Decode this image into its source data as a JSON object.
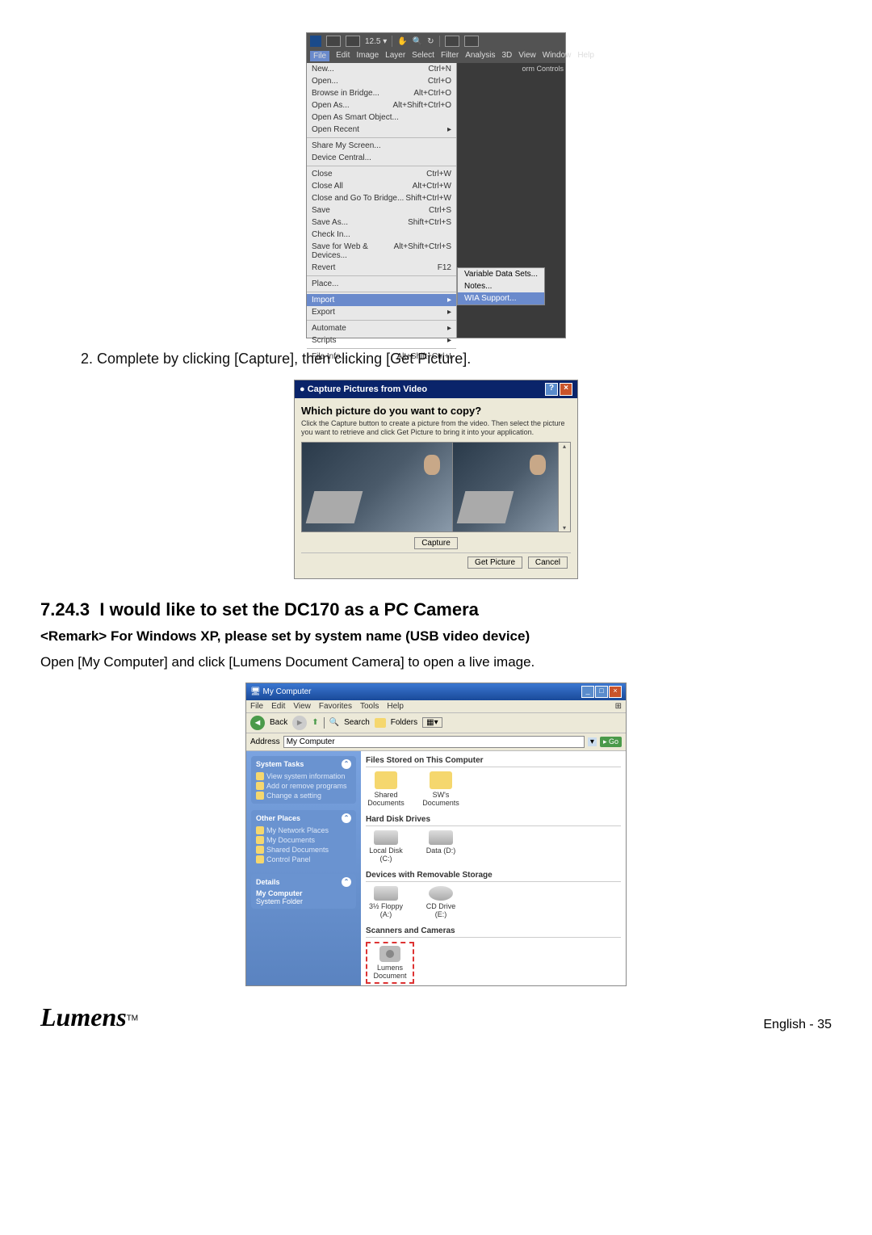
{
  "ps": {
    "zoom": "12.5 ▾",
    "menubar": [
      "File",
      "Edit",
      "Image",
      "Layer",
      "Select",
      "Filter",
      "Analysis",
      "3D",
      "View",
      "Window",
      "Help"
    ],
    "right_label": "orm Controls",
    "file_menu": [
      {
        "l": "New...",
        "s": "Ctrl+N"
      },
      {
        "l": "Open...",
        "s": "Ctrl+O"
      },
      {
        "l": "Browse in Bridge...",
        "s": "Alt+Ctrl+O"
      },
      {
        "l": "Open As...",
        "s": "Alt+Shift+Ctrl+O"
      },
      {
        "l": "Open As Smart Object...",
        "s": ""
      },
      {
        "l": "Open Recent",
        "s": "▸"
      },
      {
        "sep": true
      },
      {
        "l": "Share My Screen...",
        "s": ""
      },
      {
        "l": "Device Central...",
        "s": ""
      },
      {
        "sep": true
      },
      {
        "l": "Close",
        "s": "Ctrl+W"
      },
      {
        "l": "Close All",
        "s": "Alt+Ctrl+W"
      },
      {
        "l": "Close and Go To Bridge...",
        "s": "Shift+Ctrl+W"
      },
      {
        "l": "Save",
        "s": "Ctrl+S"
      },
      {
        "l": "Save As...",
        "s": "Shift+Ctrl+S"
      },
      {
        "l": "Check In...",
        "s": ""
      },
      {
        "l": "Save for Web & Devices...",
        "s": "Alt+Shift+Ctrl+S"
      },
      {
        "l": "Revert",
        "s": "F12"
      },
      {
        "sep": true
      },
      {
        "l": "Place...",
        "s": ""
      },
      {
        "sep": true
      },
      {
        "l": "Import",
        "s": "▸",
        "hl": true
      },
      {
        "l": "Export",
        "s": "▸"
      },
      {
        "sep": true
      },
      {
        "l": "Automate",
        "s": "▸"
      },
      {
        "l": "Scripts",
        "s": "▸"
      },
      {
        "sep": true
      },
      {
        "l": "File Info...",
        "s": "Alt+Shift+Ctrl+I"
      }
    ],
    "submenu": [
      "Variable Data Sets...",
      "Notes...",
      "WIA Support..."
    ]
  },
  "instruction2": "2.  Complete by clicking [Capture], then clicking [Get Picture].",
  "capture": {
    "title": "Capture Pictures from Video",
    "question": "Which picture do you want to copy?",
    "hint": "Click the Capture button to create a picture from the video. Then select the picture you want to retrieve and click Get Picture to bring it into your application.",
    "capture_btn": "Capture",
    "get_picture": "Get Picture",
    "cancel": "Cancel"
  },
  "section_num": "7.24.3",
  "section_title": "I would like to set the DC170 as a PC Camera",
  "remark": "<Remark> For Windows XP, please set by system name (USB video device)",
  "body_text": "Open [My Computer] and click [Lumens Document Camera] to open a live image.",
  "explorer": {
    "title": "My Computer",
    "menubar": [
      "File",
      "Edit",
      "View",
      "Favorites",
      "Tools",
      "Help"
    ],
    "back": "Back",
    "search": "Search",
    "folders": "Folders",
    "address_label": "Address",
    "address_value": "My Computer",
    "go": "Go",
    "panels": {
      "tasks": {
        "h": "System Tasks",
        "items": [
          "View system information",
          "Add or remove programs",
          "Change a setting"
        ]
      },
      "other": {
        "h": "Other Places",
        "items": [
          "My Network Places",
          "My Documents",
          "Shared Documents",
          "Control Panel"
        ]
      },
      "details": {
        "h": "Details",
        "line1": "My Computer",
        "line2": "System Folder"
      }
    },
    "sections": {
      "files": {
        "h": "Files Stored on This Computer",
        "items": [
          {
            "l1": "Shared",
            "l2": "Documents"
          },
          {
            "l1": "SW's",
            "l2": "Documents"
          }
        ]
      },
      "drives": {
        "h": "Hard Disk Drives",
        "items": [
          {
            "l": "Local Disk (C:)"
          },
          {
            "l": "Data (D:)"
          }
        ]
      },
      "removable": {
        "h": "Devices with Removable Storage",
        "items": [
          {
            "l1": "3½ Floppy",
            "l2": "(A:)"
          },
          {
            "l1": "CD Drive (E:)",
            "l2": ""
          }
        ]
      },
      "scanners": {
        "h": "Scanners and Cameras",
        "items": [
          {
            "l1": "Lumens",
            "l2": "Document"
          }
        ]
      }
    }
  },
  "logo": "Lumens",
  "tm": "TM",
  "page_label": "English - 35"
}
